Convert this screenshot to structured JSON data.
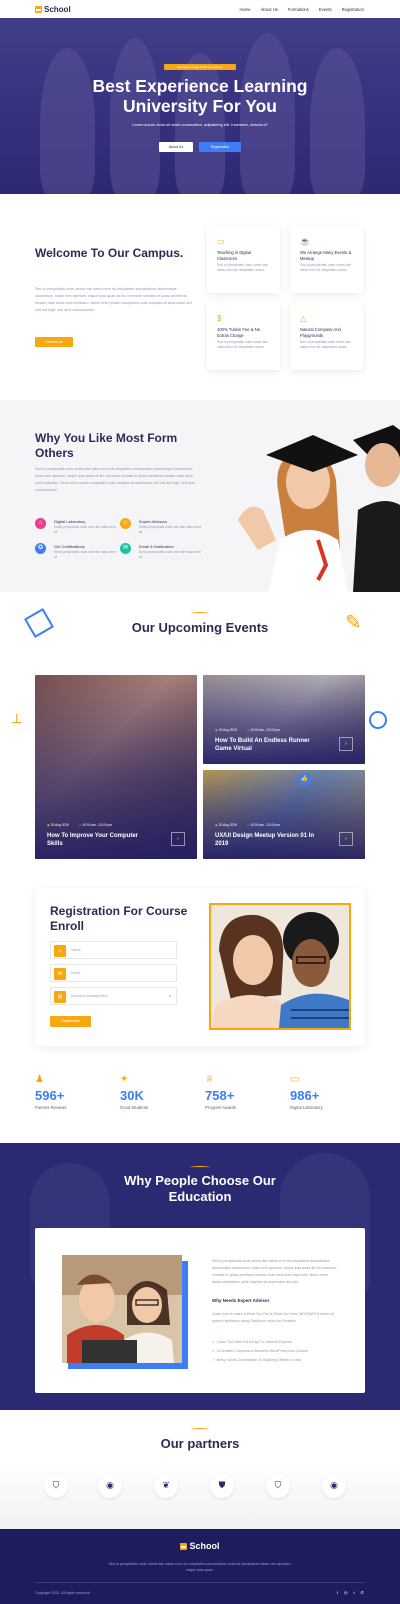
{
  "brand": {
    "name": "School"
  },
  "nav": [
    "Home",
    "About Us",
    "Formations",
    "Events",
    "Registration"
  ],
  "hero": {
    "tag": "Education make bright your future",
    "title": "Best Experience Learning University For You",
    "subtitle": "Lorem ipsum dolor sit amet consectetur, adipisicing elit. Inventore, deserunt?",
    "btn_about": "About Us",
    "btn_register": "Registration"
  },
  "welcome": {
    "title": "Welcome To Our Campus.",
    "text": "Sed ut perspiciatis unde omnis iste natus error sit voluptatem accusantium doloremque laudantium, totam rem aperiam, eaque ipsa quae ab illo inventore veritatis et quasi architecto beatae vitae dicta sunt explicabo. Nemo enim ipsam voluptatem quia voluptas sit aspernatur aut odit aut fugit, sed quia consequuntur.",
    "button": "Contact Us",
    "features": [
      {
        "title": "Teaching in Digital Classroom",
        "text": "Sed ut perspiciatis unde omnis iste natus error sit voluptatem accus"
      },
      {
        "title": "We Arrange Many Events & Meetup",
        "text": "Sed ut perspiciatis unde omnis iste natus error sit voluptatem accus"
      },
      {
        "title": "100% Tuition Fee & No Extras Charge",
        "text": "Sed ut perspiciatis unde omnis iste natus error sit voluptatem accus"
      },
      {
        "title": "Natural Compass And Playgrounds",
        "text": "Sed ut perspiciatis unde omnis iste natus error sit voluptatem accus"
      }
    ]
  },
  "why": {
    "title": "Why You Like Most Form Others",
    "text": "Sed ut perspiciatis unde omnis iste natus error sit voluptatem accusantium doloremque laudantium, totam rem aperiam, eaque ipsa quae ab illo inventore veritatis et quasi architecto beatae vitae dicta sunt explicabo. Nemo enim ipsam voluptatem quia voluptas sit aspernatur aut odit aut fugit, sed quia consequuntur.",
    "items": [
      {
        "title": "Digital Laboratory",
        "text": "Sedut perspiciatis unde omn iste natus error sit",
        "color": "#e83e8c"
      },
      {
        "title": "Expert Advisors",
        "text": "Sedut perspiciatis unde omn iste natus error sit",
        "color": "#f7a811"
      },
      {
        "title": "Get Certifications",
        "text": "Sedut perspiciatis unde omn iste natus error sit",
        "color": "#3d7ef6"
      },
      {
        "title": "Email & Notification",
        "text": "Sedut perspiciatis unde omn iste natus error sit",
        "color": "#22c0a0"
      }
    ]
  },
  "events": {
    "title": "Our Upcoming Events",
    "items": [
      {
        "date": "20 Aug 2019",
        "time": "10:00 am - 01:00 pm",
        "title": "How To Improve Your Computer Skills"
      },
      {
        "date": "20 Aug 2019",
        "time": "10:00 am - 01:00 pm",
        "title": "How To Build An Endless Runner Game Virtual"
      },
      {
        "date": "20 Aug 2019",
        "time": "10:00 am - 01:00 pm",
        "title": "UX/UI Design Meetup Version 01 In 2019"
      }
    ]
  },
  "registration": {
    "title": "Registration For Course Enroll",
    "name_placeholder": "Name",
    "email_placeholder": "Email",
    "select_value": "Business Management",
    "button": "Registration"
  },
  "stats": [
    {
      "value": "596+",
      "label": "Parents Reviews"
    },
    {
      "value": "30K",
      "label": "Good Students"
    },
    {
      "value": "758+",
      "label": "Program Awards"
    },
    {
      "value": "986+",
      "label": "Digital Laboratory"
    }
  ],
  "choose": {
    "title": "Why People Choose Our Education",
    "text": "Sed ut perspiciatis unde omnis iste natus error sit voluptatem accusantium doloremque laudantium, totam rem aperiam, eaque ipsa quae ab illo inventore veritatis et quasi architecto beatae vitae dicta sunt explicabo. Nemo enim ipsam voluptatem quia voluptas sit aspernatur aut odit.",
    "subtitle": "Why Needs Expert Advisor",
    "text2": "Learn how to make a What You Get Is What You Hear (WYGIWYH) editor for speech synthesis using Gatsby.sh editor for Portable",
    "list": [
      "Learn The Web For A Day For Internet Explorer",
      "A Detailed Comparison Between WordPress And October",
      "Bring Sports Commission To Building A Better Crowd"
    ]
  },
  "partners": {
    "title": "Our partners"
  },
  "footer": {
    "text": "Sed ut perspiciatis unde omnis iste natus error sit voluptatem accusantium dolotrue laudantium totam rem aperiam, eaque ipsa quae.",
    "copyright": "Copyright 2021. All rights reserved",
    "social": [
      "f",
      "◎",
      "t",
      "✆"
    ]
  }
}
